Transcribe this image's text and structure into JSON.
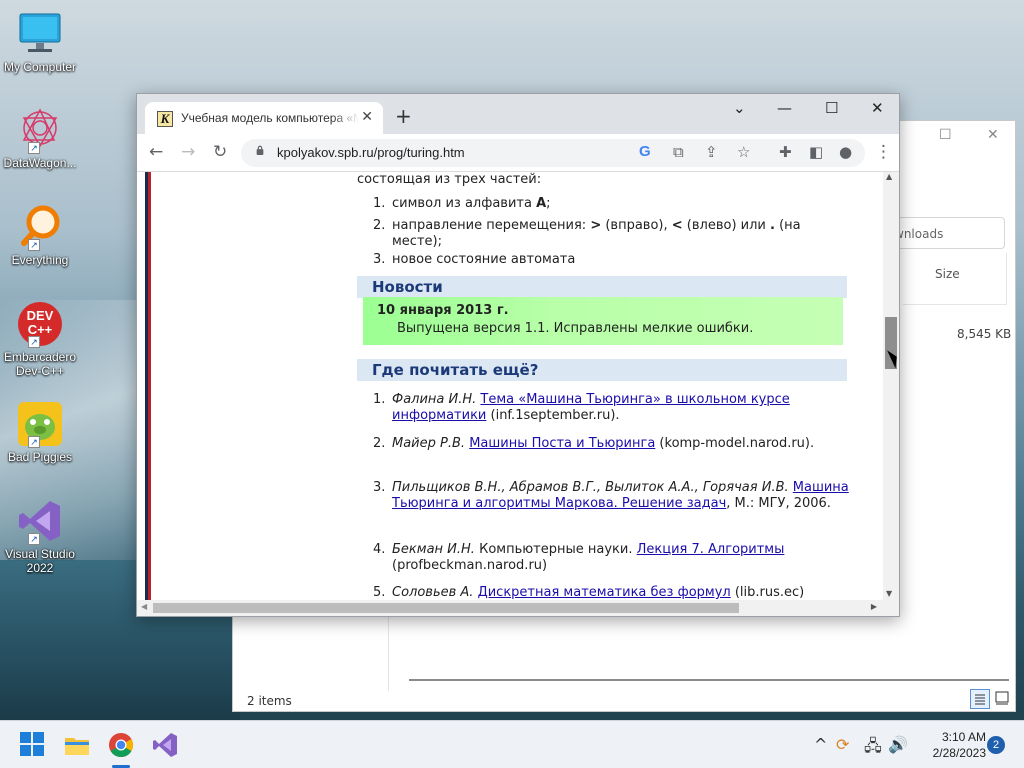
{
  "desktop": {
    "icons": [
      {
        "label": "My Computer"
      },
      {
        "label": "DataWagon..."
      },
      {
        "label": "Everything"
      },
      {
        "label": "Embarcadero Dev-C++",
        "badge_text": "DEV C++"
      },
      {
        "label": "Bad Piggies"
      },
      {
        "label": "Visual Studio 2022"
      }
    ]
  },
  "explorer": {
    "search_placeholder": "wnloads",
    "column_size": "Size",
    "file_size": "8,545 KB",
    "status": "2 items"
  },
  "browser": {
    "tab_title": "Учебная модель компьютера «Машина Тьюринга»",
    "url": "kpolyakov.spb.ru/prog/turing.htm",
    "favicon_letter": "K",
    "page": {
      "intro": "состоящая из трех частей:",
      "parts": [
        {
          "n": "1.",
          "pre": "символ из алфавита ",
          "bold": "A",
          "post": ";"
        },
        {
          "n": "2.",
          "text_a": "направление перемещения: ",
          "gt": ">",
          "text_b": " (вправо), ",
          "lt": "<",
          "text_c": " (влево) или ",
          "dot": ".",
          "text_d": " (на месте);"
        },
        {
          "n": "3.",
          "text": "новое состояние автомата"
        }
      ],
      "news_heading": "Новости",
      "news_date": "10 января 2013 г.",
      "news_text": "Выпущена версия 1.1. Исправлены мелкие ошибки.",
      "read_heading": "Где почитать ещё?",
      "refs": [
        {
          "n": "1.",
          "author": "Фалина И.Н.",
          "link": "Тема «Машина Тьюринга» в школьном курсе информатики",
          "after": " (inf.1september.ru)."
        },
        {
          "n": "2.",
          "author": "Майер Р.В.",
          "link": "Машины Поста и Тьюринга",
          "after": " (komp-model.narod.ru)."
        },
        {
          "n": "3.",
          "author": "Пильщиков В.Н., Абрамов В.Г., Вылиток А.А., Горячая И.В.",
          "link": "Машина Тьюринга и алгоритмы Маркова. Решение задач",
          "after": ", М.: МГУ, 2006."
        },
        {
          "n": "4.",
          "author": "Бекман И.Н.",
          "plain": " Компьютерные науки. ",
          "link": "Лекция 7. Алгоритмы",
          "after": " (profbeckman.narod.ru)"
        },
        {
          "n": "5.",
          "author": "Соловьев А.",
          "link": "Дискретная математика без формул",
          "after": " (lib.rus.ec)"
        }
      ]
    }
  },
  "taskbar": {
    "time": "3:10 AM",
    "date": "2/28/2023",
    "notification_count": "2"
  }
}
